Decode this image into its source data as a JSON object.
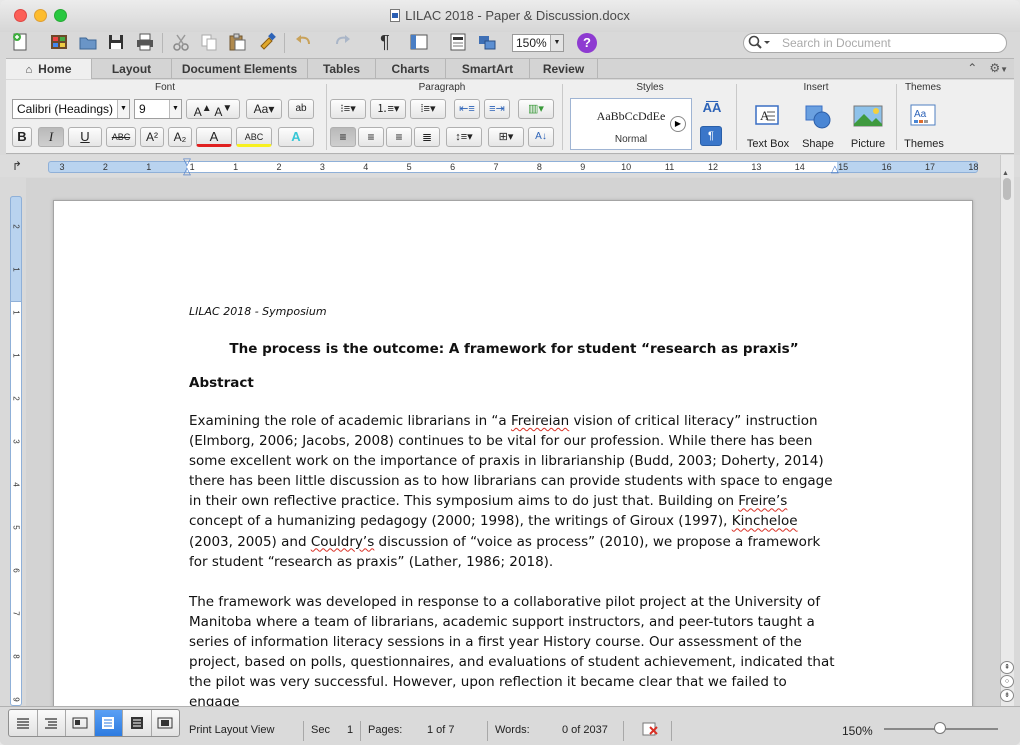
{
  "window": {
    "title": "LILAC 2018 - Paper & Discussion.docx"
  },
  "toolbar": {
    "zoom": "150%",
    "search_placeholder": "Search in Document",
    "help_glyph": "?"
  },
  "tabs": [
    {
      "label": "Home",
      "active": true
    },
    {
      "label": "Layout"
    },
    {
      "label": "Document Elements"
    },
    {
      "label": "Tables"
    },
    {
      "label": "Charts"
    },
    {
      "label": "SmartArt"
    },
    {
      "label": "Review"
    }
  ],
  "ribbon": {
    "groups": {
      "font": "Font",
      "paragraph": "Paragraph",
      "styles": "Styles",
      "insert": "Insert",
      "themes": "Themes"
    },
    "font_name": "Calibri (Headings)",
    "font_size": "9",
    "style_sample": "AaBbCcDdEe",
    "style_name": "Normal",
    "insert_items": {
      "textbox": "Text Box",
      "shape": "Shape",
      "picture": "Picture"
    },
    "themes_label": "Themes",
    "format_buttons": {
      "bold": "B",
      "italic": "I",
      "underline": "U",
      "strike": "ABC",
      "superscript": "A²",
      "subscript": "A₂",
      "font_color": "A",
      "highlight": "ABC",
      "text_effects": "A"
    }
  },
  "ruler": {
    "labels": [
      "3",
      "2",
      "1",
      "1",
      "1",
      "2",
      "3",
      "4",
      "5",
      "6",
      "7",
      "8",
      "9",
      "10",
      "11",
      "12",
      "13",
      "14",
      "15",
      "16",
      "17",
      "18"
    ],
    "vertical_labels": [
      "2",
      "1",
      "1",
      "1",
      "2",
      "3",
      "4",
      "5",
      "6",
      "7",
      "8",
      "9"
    ]
  },
  "document": {
    "header": "LILAC 2018 - Symposium",
    "title": "The process is the outcome: A framework for student “research as praxis”",
    "section": "Abstract",
    "p1": {
      "a": "Examining the role of academic librarians in “a ",
      "b": "Freireian",
      "c": " vision of critical literacy” instruction (Elmborg, 2006; Jacobs, 2008) continues to be vital for our profession. While there has been some excellent work on the importance of praxis in librarianship (Budd, 2003; Doherty, 2014) there has been little discussion as to how librarians can provide students with space to engage in their own reflective practice. This symposium aims to do just that. Building on ",
      "d": "Freire’s",
      "e": " concept of a humanizing pedagogy (2000; 1998), the writings of Giroux (1997), ",
      "f": "Kincheloe",
      "g": " (2003, 2005) and ",
      "h": "Couldry’s",
      "i": " discussion of “voice as process” (2010), we propose a framework for student “research as praxis” (Lather, 1986; 2018)."
    },
    "p2": "The framework was developed in response to a collaborative pilot project at the University of Manitoba where a team of librarians, academic support instructors, and peer-tutors taught a series of information literacy sessions in a first year History course. Our assessment of the project, based on polls, questionnaires, and evaluations of student achievement, indicated that the pilot was very successful. However, upon reflection it became clear that we failed to engage"
  },
  "status": {
    "view": "Print Layout View",
    "sec_label": "Sec",
    "sec_value": "1",
    "pages_label": "Pages:",
    "pages_value": "1 of 7",
    "words_label": "Words:",
    "words_value": "0 of 2037",
    "zoom": "150%"
  },
  "colors": {
    "accent_blue": "#2d7be0",
    "spell_red": "#d93025",
    "help_purple": "#8e3bd1"
  }
}
